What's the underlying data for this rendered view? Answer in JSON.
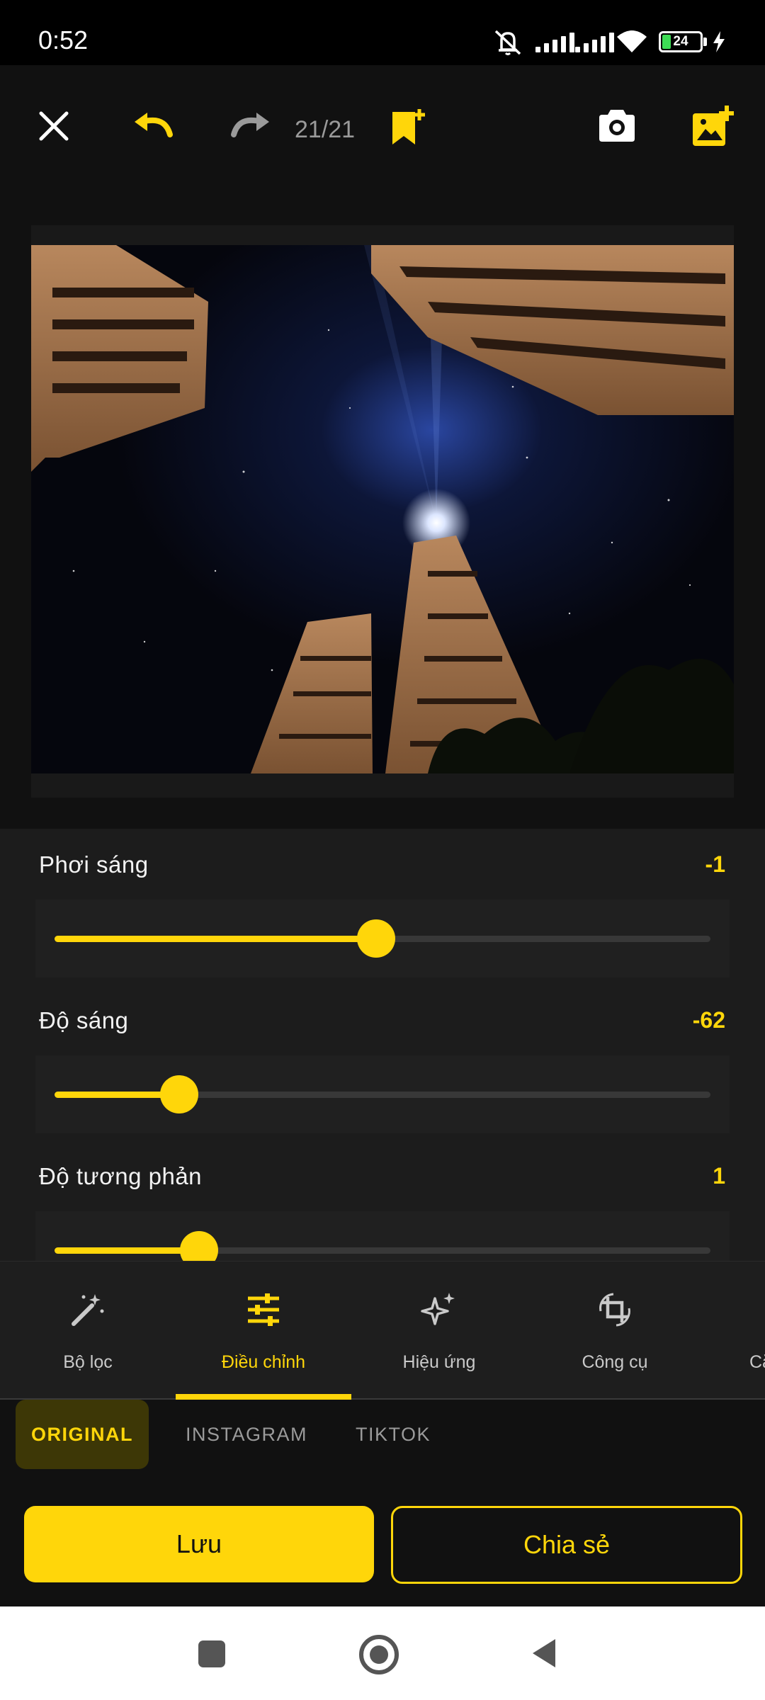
{
  "status_bar": {
    "time": "0:52",
    "battery_level": "24",
    "icons": [
      "mute-icon",
      "signal-icon",
      "signal-icon",
      "wifi-icon",
      "battery-icon",
      "charging-icon"
    ]
  },
  "toolbar": {
    "counter": "21/21",
    "icons": [
      "close-icon",
      "undo-icon",
      "redo-icon",
      "bookmark-add-icon",
      "camera-icon",
      "add-image-icon"
    ],
    "colors": {
      "accent": "#ffd60a",
      "disabled": "#9a9a9a"
    }
  },
  "photo": {
    "description_icon": "photo-icon"
  },
  "adjustments": [
    {
      "label": "Phơi sáng",
      "value": "-1",
      "fraction": 0.49
    },
    {
      "label": "Độ sáng",
      "value": "-62",
      "fraction": 0.19
    },
    {
      "label": "Độ tương phản",
      "value": "1",
      "fraction": 0.22
    }
  ],
  "tabs": [
    {
      "label": "Bộ lọc",
      "icon": "magic-wand-icon",
      "active": false
    },
    {
      "label": "Điều chỉnh",
      "icon": "sliders-icon",
      "active": true
    },
    {
      "label": "Hiệu ứng",
      "icon": "sparkle-icon",
      "active": false
    },
    {
      "label": "Công cụ",
      "icon": "crop-rotate-icon",
      "active": false
    },
    {
      "label": "Cắ",
      "icon": "",
      "active": false
    }
  ],
  "formats": [
    "ORIGINAL",
    "INSTAGRAM",
    "TIKTOK"
  ],
  "actions": {
    "save": "Lưu",
    "share": "Chia sẻ"
  },
  "navbar": {
    "icons": [
      "recents-icon",
      "home-icon",
      "back-icon"
    ]
  }
}
